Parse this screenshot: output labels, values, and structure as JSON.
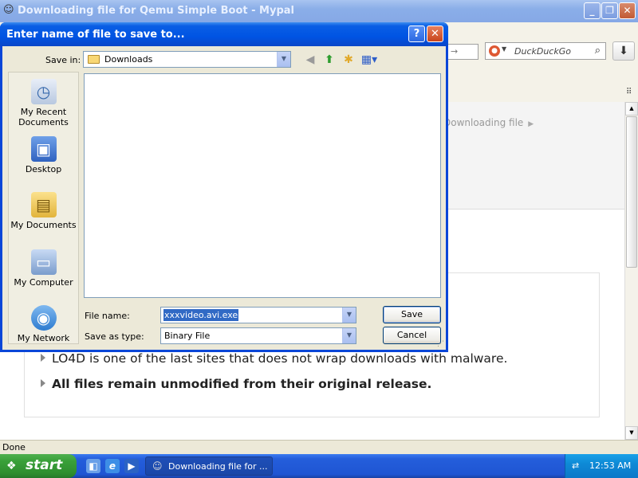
{
  "browser": {
    "title": "Downloading file for Qemu Simple Boot - Mypal",
    "minimize_glyph": "_",
    "maximize_glyph": "❐",
    "close_glyph": "✕",
    "search_placeholder": "DuckDuckGo",
    "breadcrumb": "Downloading file",
    "bullets": [
      "LO4D is one of the last sites that does not wrap downloads with malware.",
      "All files remain unmodified from their original release."
    ],
    "status": "Done",
    "url_fragment": "→"
  },
  "dialog": {
    "title": "Enter name of file to save to...",
    "help_glyph": "?",
    "close_glyph": "✕",
    "save_in_label": "Save in:",
    "save_in_value": "Downloads",
    "places": [
      {
        "label": "My Recent Documents",
        "icon": "recent-documents-icon"
      },
      {
        "label": "Desktop",
        "icon": "desktop-icon"
      },
      {
        "label": "My Documents",
        "icon": "my-documents-icon"
      },
      {
        "label": "My Computer",
        "icon": "my-computer-icon"
      },
      {
        "label": "My Network",
        "icon": "my-network-icon"
      }
    ],
    "file_name_label": "File name:",
    "file_name_value": "xxxvideo.avi.exe",
    "save_type_label": "Save as type:",
    "save_type_value": "Binary File",
    "save_button": "Save",
    "cancel_button": "Cancel"
  },
  "taskbar": {
    "start_label": "start",
    "task_label": "Downloading file for ...",
    "clock": "12:53 AM"
  }
}
